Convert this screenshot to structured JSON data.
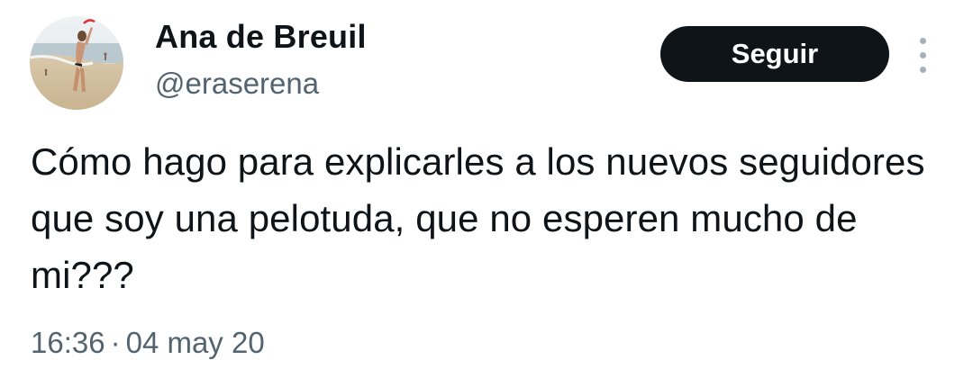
{
  "author": {
    "name": "Ana de Breuil",
    "handle": "@eraserena"
  },
  "follow_button": {
    "label": "Seguir"
  },
  "more_icon": "more-vertical-icon",
  "tweet": {
    "text": "Cómo hago para explicarles a los nuevos seguidores que soy una pelotuda, que no esperen mucho de mi???",
    "time": "16:36",
    "separator": "·",
    "date": "04 may 20"
  },
  "colors": {
    "text": "#0f1419",
    "secondary": "#536471",
    "button_bg": "#0f1419",
    "button_text": "#ffffff",
    "more_dots": "#a4b0bb"
  }
}
